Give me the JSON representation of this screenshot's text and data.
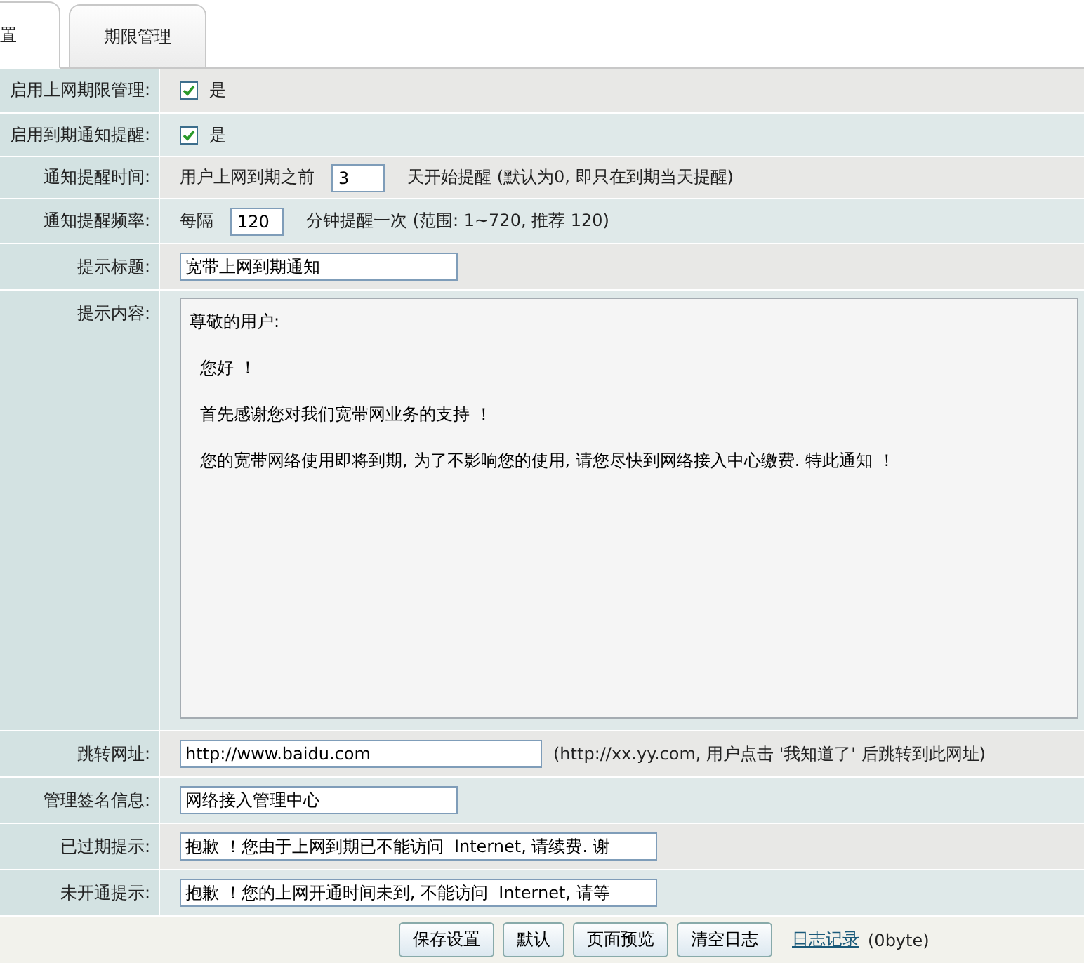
{
  "tabs": [
    {
      "label": "置",
      "selected": true
    },
    {
      "label": "期限管理",
      "selected": false
    }
  ],
  "rows": [
    {
      "kind": "checkbox",
      "label": "启用上网期限管理:",
      "checked": true,
      "option": "是"
    },
    {
      "kind": "checkbox",
      "label": "启用到期通知提醒:",
      "checked": true,
      "option": "是"
    },
    {
      "kind": "number",
      "label": "通知提醒时间:",
      "prefix": "用户上网到期之前",
      "value": "3",
      "suffix": "天开始提醒 (默认为0, 即只在到期当天提醒)"
    },
    {
      "kind": "number",
      "label": "通知提醒频率:",
      "prefix": "每隔",
      "value": "120",
      "suffix": "分钟提醒一次 (范围: 1~720, 推荐  120)"
    },
    {
      "kind": "text",
      "label": "提示标题:",
      "value": "宽带上网到期通知"
    },
    {
      "kind": "textarea",
      "label": "提示内容:",
      "paragraphs": [
        "尊敬的用户:",
        "  您好 ！",
        "  首先感谢您对我们宽带网业务的支持 ！",
        "  您的宽带网络使用即将到期, 为了不影响您的使用, 请您尽快到网络接入中心缴费. 特此通知 ！"
      ]
    },
    {
      "kind": "text",
      "label": "跳转网址:",
      "value": "http://www.baidu.com",
      "hint": "(http://xx.yy.com, 用户点击 '我知道了' 后跳转到此网址)"
    },
    {
      "kind": "text",
      "label": "管理签名信息:",
      "value": "网络接入管理中心"
    },
    {
      "kind": "wide",
      "label": "已过期提示:",
      "value": "抱歉 ！您由于上网到期已不能访问  Internet, 请续费. 谢"
    },
    {
      "kind": "wide",
      "label": "未开通提示:",
      "value": "抱歉 ！您的上网开通时间未到, 不能访问  Internet, 请等"
    }
  ],
  "buttons": [
    "保存设置",
    "默认",
    "页面预览",
    "清空日志"
  ],
  "log_link": "日志记录",
  "log_size": "(0byte)"
}
